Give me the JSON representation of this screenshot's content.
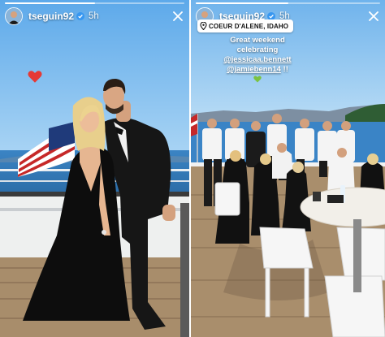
{
  "stories": [
    {
      "username": "tseguin92",
      "timestamp": "5h",
      "progress": 0.5,
      "icons": {
        "verified": "verified-badge-icon",
        "close": "close-icon",
        "heart": "red-heart-sticker"
      }
    },
    {
      "username": "tseguin92",
      "timestamp": "5h",
      "progress": 0.5,
      "location": "COEUR D'ALENE, IDAHO",
      "caption": {
        "line1": "Great weekend",
        "line2": "celebrating",
        "mention1": "@jessicaa.bennett",
        "mention2": "@jamiebenn14",
        "suffix": " !!"
      },
      "icons": {
        "verified": "verified-badge-icon",
        "close": "close-icon",
        "location": "location-pin-icon",
        "heart": "green-heart-emoji"
      }
    }
  ],
  "colors": {
    "verified": "#3897f0",
    "sky": "#8ec4f0",
    "lake": "#2f78b8",
    "heart_red": "#e53935",
    "heart_green": "#7cc242"
  }
}
